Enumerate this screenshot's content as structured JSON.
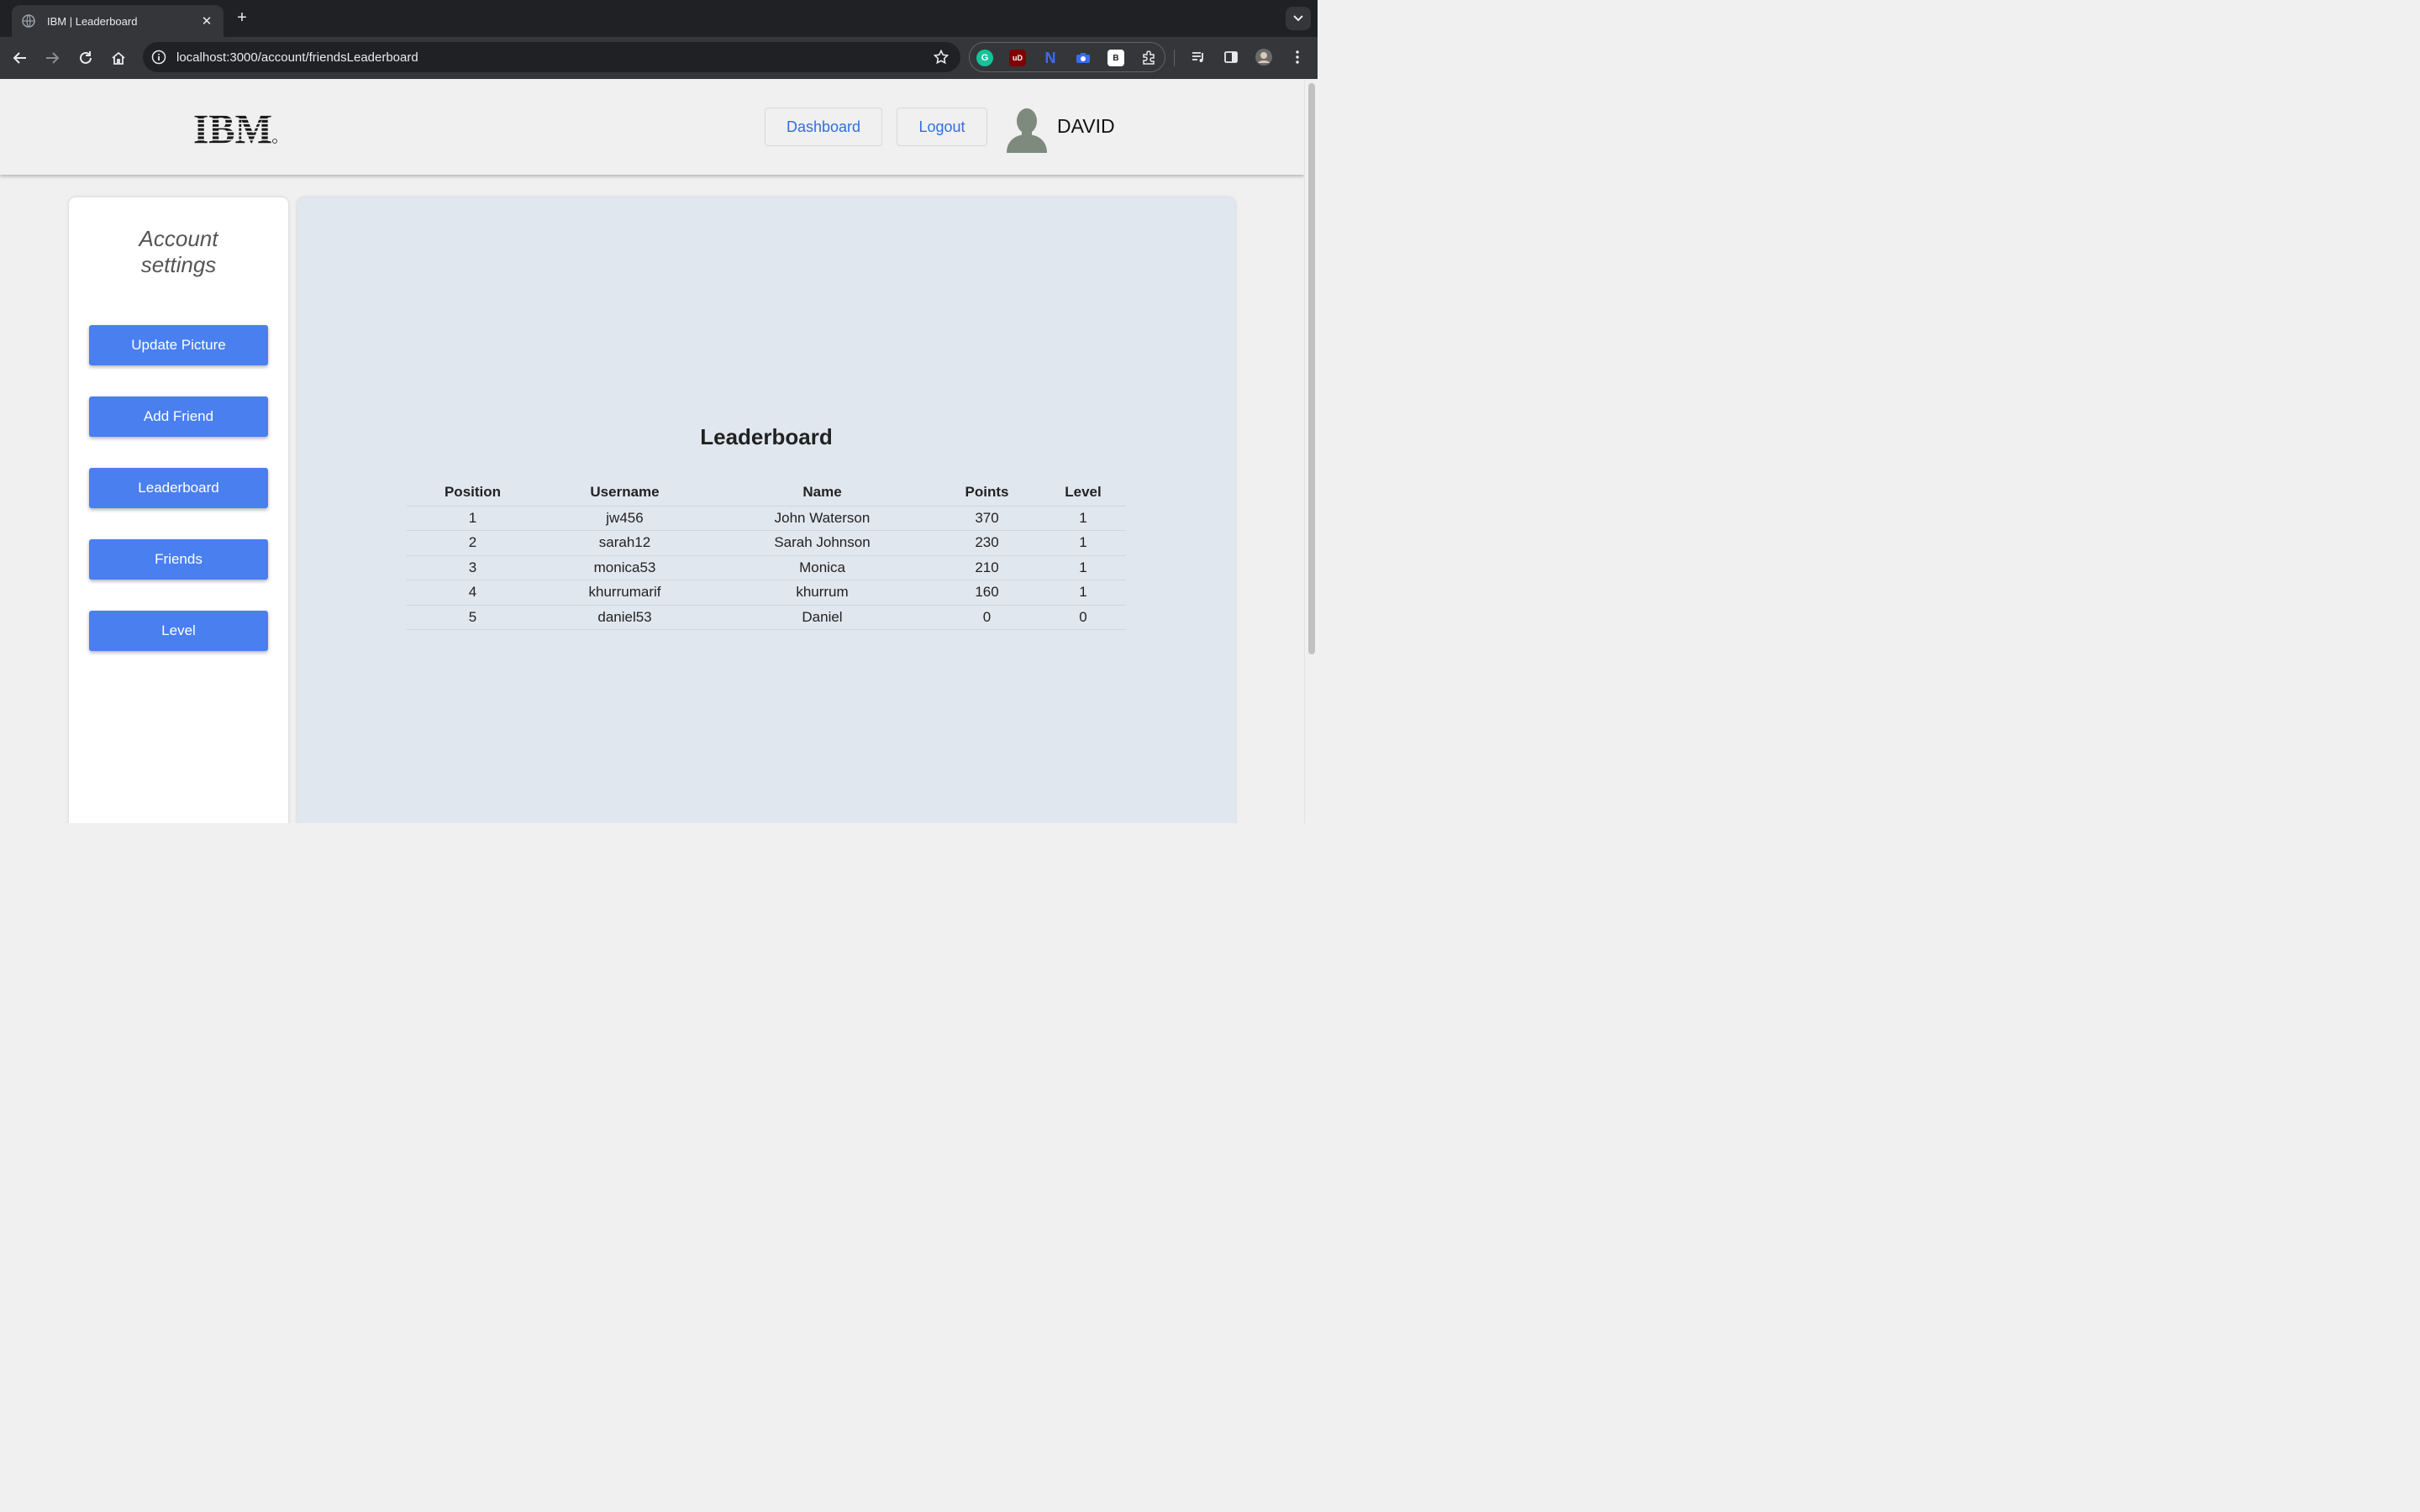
{
  "browser": {
    "tab_title": "IBM | Leaderboard",
    "url": "localhost:3000/account/friendsLeaderboard",
    "extensions": [
      {
        "name": "grammarly-icon",
        "label": "G",
        "color": "#15c39a"
      },
      {
        "name": "ublock-icon",
        "label": "uD",
        "color": "#800000"
      },
      {
        "name": "n-extension-icon",
        "label": "N",
        "color": "#3b6cf6"
      },
      {
        "name": "camera-icon",
        "label": "",
        "color": "#3b6cf6"
      },
      {
        "name": "b-extension-icon",
        "label": "B",
        "color": "#ffffff"
      }
    ]
  },
  "header": {
    "logo_text": "IBM",
    "dashboard_label": "Dashboard",
    "logout_label": "Logout",
    "username": "DAVID"
  },
  "sidebar": {
    "title": "Account settings",
    "buttons": [
      {
        "label": "Update Picture"
      },
      {
        "label": "Add Friend"
      },
      {
        "label": "Leaderboard"
      },
      {
        "label": "Friends"
      },
      {
        "label": "Level"
      }
    ]
  },
  "leaderboard": {
    "title": "Leaderboard",
    "columns": [
      "Position",
      "Username",
      "Name",
      "Points",
      "Level"
    ],
    "rows": [
      [
        "1",
        "jw456",
        "John Waterson",
        "370",
        "1"
      ],
      [
        "2",
        "sarah12",
        "Sarah Johnson",
        "230",
        "1"
      ],
      [
        "3",
        "monica53",
        "Monica",
        "210",
        "1"
      ],
      [
        "4",
        "khurrumarif",
        "khurrum",
        "160",
        "1"
      ],
      [
        "5",
        "daniel53",
        "Daniel",
        "0",
        "0"
      ]
    ]
  },
  "colors": {
    "accent": "#4a7ff0",
    "link": "#2f6fe0",
    "main_panel": "#e1e7ef"
  }
}
